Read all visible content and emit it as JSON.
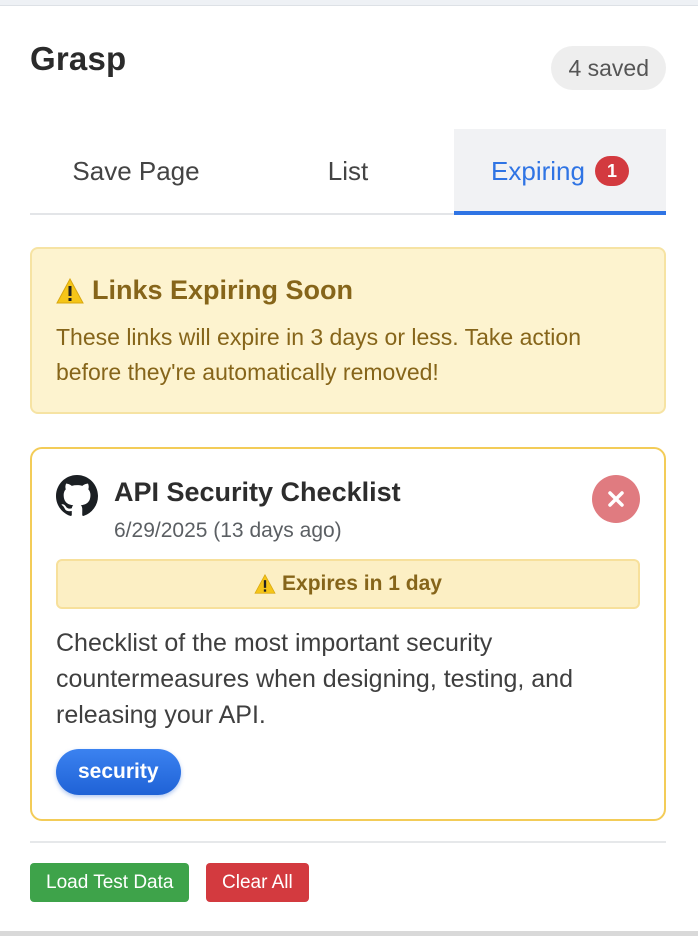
{
  "header": {
    "title": "Grasp",
    "saved_count": "4 saved"
  },
  "tabs": [
    {
      "label": "Save Page",
      "active": false
    },
    {
      "label": "List",
      "active": false
    },
    {
      "label": "Expiring",
      "active": true,
      "badge": "1"
    }
  ],
  "notice": {
    "title": "Links Expiring Soon",
    "text": "These links will expire in 3 days or less. Take action before they're automatically removed!",
    "icon": "warning-icon"
  },
  "cards": [
    {
      "icon": "github-icon",
      "title": "API Security Checklist",
      "date": "6/29/2025 (13 days ago)",
      "expires": "Expires in 1 day",
      "description": "Checklist of the most important security countermeasures when designing, testing, and releasing your API.",
      "tags": [
        "security"
      ]
    }
  ],
  "footer": {
    "load_label": "Load Test Data",
    "clear_label": "Clear All"
  },
  "colors": {
    "accent": "#2f74e4",
    "danger": "#d33a3f",
    "success": "#3ea34a",
    "warning_bg": "#fdf3cf",
    "warning_text": "#86651a"
  }
}
